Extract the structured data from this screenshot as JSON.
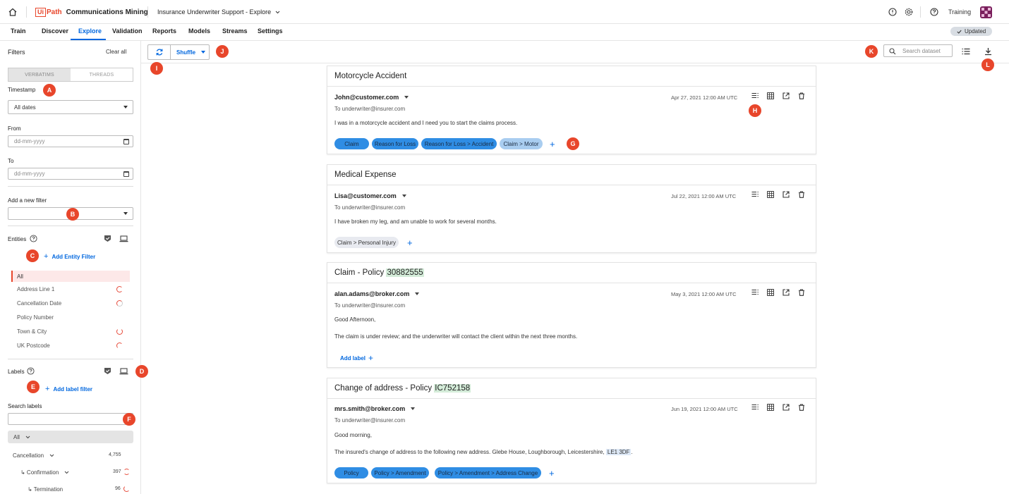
{
  "header": {
    "brand_ui": "Ui",
    "brand_path": "Path",
    "product": "Communications Mining",
    "project": "Insurance Underwriter Support - Explore",
    "user": "Training"
  },
  "nav": {
    "tabs": [
      "Train",
      "Discover",
      "Explore",
      "Validation",
      "Reports",
      "Models",
      "Streams",
      "Settings"
    ],
    "active": "Explore",
    "status": "Updated"
  },
  "sidebar": {
    "title": "Filters",
    "clear_all": "Clear all",
    "seg_verbatims": "VERBATIMS",
    "seg_threads": "THREADS",
    "timestamp_label": "Timestamp",
    "timestamp_value": "All dates",
    "from_label": "From",
    "from_placeholder": "dd-mm-yyyy",
    "to_label": "To",
    "to_placeholder": "dd-mm-yyyy",
    "add_filter_label": "Add a new filter",
    "entities_label": "Entities",
    "add_entity_filter": "Add Entity Filter",
    "entities": [
      "All",
      "Address Line 1",
      "Cancellation Date",
      "Policy Number",
      "Town & City",
      "UK Postcode"
    ],
    "labels_label": "Labels",
    "add_label_filter": "Add label filter",
    "search_labels_label": "Search labels",
    "labels_all": "All",
    "label_tree": [
      {
        "name": "Cancellation",
        "count": "4,755"
      },
      {
        "name": "↳ Confirmation",
        "count": "397"
      },
      {
        "name": "↳ Termination",
        "count": "96"
      }
    ]
  },
  "toolbar": {
    "shuffle": "Shuffle",
    "search_placeholder": "Search dataset"
  },
  "messages": [
    {
      "title": "Motorcycle Accident",
      "title_hl": "",
      "from": "John@customer.com",
      "to": "To underwriter@insurer.com",
      "date": "Apr 27, 2021 12:00 AM UTC",
      "body1": "I was in a motorcycle accident and I need you to start the claims process.",
      "body2": "",
      "labels": [
        "Claim",
        "Reason for Loss",
        "Reason for Loss > Accident",
        "Claim > Motor"
      ]
    },
    {
      "title": "Medical Expense",
      "title_hl": "",
      "from": "Lisa@customer.com",
      "to": "To underwriter@insurer.com",
      "date": "Jul 22, 2021 12:00 AM UTC",
      "body1": "I have broken my leg, and am unable to work for several months.",
      "body2": "",
      "labels": [
        "Claim > Personal Injury"
      ]
    },
    {
      "title": "Claim - Policy ",
      "title_hl": "30882555",
      "from": "alan.adams@broker.com",
      "to": "To underwriter@insurer.com",
      "date": "May 3, 2021 12:00 AM UTC",
      "body1": "Good Afternoon,",
      "body2": "The claim is under review; and the underwriter will contact the client within the next three months.",
      "add_label": "Add label",
      "labels": []
    },
    {
      "title": "Change of address - Policy ",
      "title_hl": "IC752158",
      "from": "mrs.smith@broker.com",
      "to": "To underwriter@insurer.com",
      "date": "Jun 19, 2021 12:00 AM UTC",
      "body1": "Good morning,",
      "body2": "The insured's change of address to the following new address. Glebe House, Loughborough, Leicestershire, ",
      "body2_hl": "LE1 3DF",
      "body2_end": ".",
      "labels": [
        "Policy",
        "Policy > Amendment",
        "Policy > Amendment > Address Change"
      ]
    }
  ],
  "markers": [
    "A",
    "B",
    "C",
    "D",
    "E",
    "F",
    "G",
    "H",
    "I",
    "J",
    "K",
    "L"
  ],
  "colors": {
    "accent": "#0067df",
    "brand": "#e8462b",
    "label_chip": "#2f8de4",
    "label_chip_light": "#a9cdf0"
  }
}
